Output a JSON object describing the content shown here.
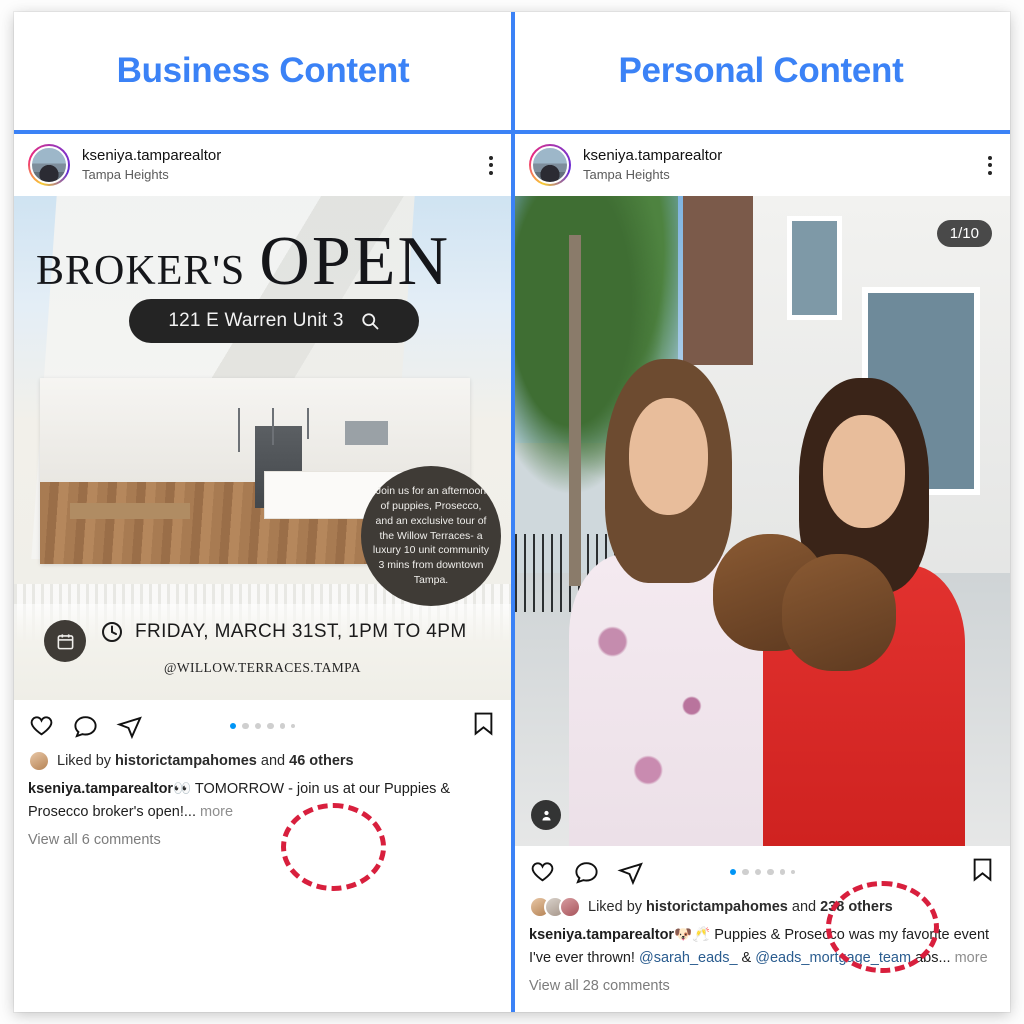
{
  "headers": {
    "left": "Business Content",
    "right": "Personal Content",
    "accent_color": "#3b82f6"
  },
  "left_post": {
    "account": {
      "username": "kseniya.tamparealtor",
      "location": "Tampa Heights",
      "avatar_icon": "profile-photo",
      "menu_icon": "more-options-icon"
    },
    "flyer": {
      "title_part1": "BROKER'S",
      "title_part2": "OPEN",
      "address": "121 E Warren Unit 3",
      "search_icon": "magnifier-icon",
      "circle_note": "Join us for an afternoon of puppies, Prosecco, and an exclusive tour of the Willow Terraces- a luxury 10 unit community 3 mins from downtown Tampa.",
      "calendar_icon": "calendar-icon",
      "clock_icon": "clock-icon",
      "date_time": "FRIDAY, MARCH 31ST,  1PM TO 4PM",
      "handle": "@WILLOW.TERRACES.TAMPA"
    },
    "actions": {
      "like_icon": "heart-icon",
      "comment_icon": "comment-bubble-icon",
      "share_icon": "share-paperplane-icon",
      "save_icon": "bookmark-icon",
      "dots_total": 6,
      "dot_active": 1
    },
    "likes": {
      "prefix": "Liked by ",
      "account": "historictampahomes",
      "joiner": " and ",
      "others": "46 others"
    },
    "caption": {
      "username": "kseniya.tamparealtor",
      "emoji": "👀",
      "text": " TOMORROW - join us at our Puppies & Prosecco broker's open!...",
      "more": " more"
    },
    "comments_link": "View all 6 comments"
  },
  "right_post": {
    "account": {
      "username": "kseniya.tamparealtor",
      "location": "Tampa Heights",
      "avatar_icon": "profile-photo",
      "menu_icon": "more-options-icon"
    },
    "media": {
      "carousel_counter": "1/10",
      "tag_icon": "person-tag-icon",
      "description": "two-women-holding-puppies-outside-townhomes"
    },
    "actions": {
      "like_icon": "heart-icon",
      "comment_icon": "comment-bubble-icon",
      "share_icon": "share-paperplane-icon",
      "save_icon": "bookmark-icon",
      "dots_total": 6,
      "dot_active": 1
    },
    "likes": {
      "prefix": "Liked by ",
      "account": "historictampahomes",
      "joiner": " and ",
      "others": "238 others"
    },
    "caption": {
      "username": "kseniya.tamparealtor",
      "emoji": "🐶🥂",
      "text": " Puppies & Prosecco was my favorite event I've ever thrown! ",
      "mention1": "@sarah_eads_",
      "amp": " & ",
      "mention2": "@eads_mortgage_team",
      "tail": " abs...",
      "more": " more"
    },
    "comments_link": "View all 28 comments"
  },
  "annotations": {
    "circle_color": "#d81f3d",
    "left_circle_target": "46 others",
    "right_circle_target": "238 others"
  }
}
